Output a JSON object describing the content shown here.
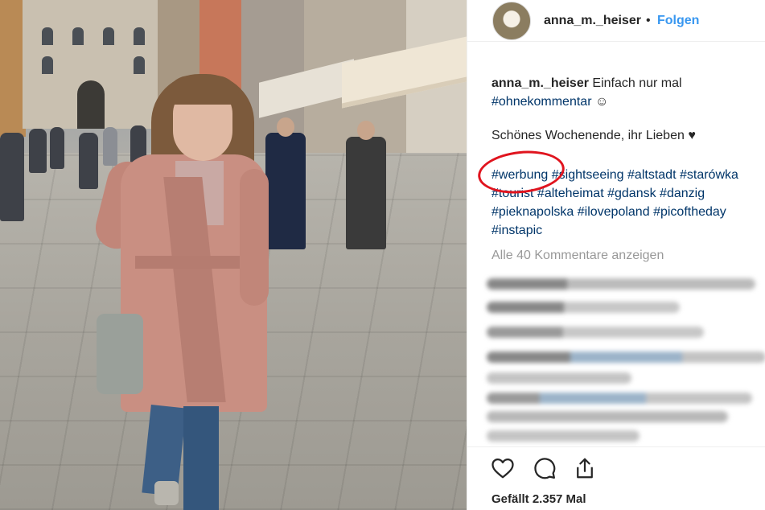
{
  "post": {
    "username": "anna_m._heiser",
    "separator": "•",
    "follow_label": "Folgen"
  },
  "caption": {
    "username": "anna_m._heiser",
    "text": "Einfach nur mal",
    "hashtag_1": "#ohnekommentar",
    "emoji": "☺",
    "line_2": "Schönes Wochenende, ihr Lieben ♥",
    "hashtags_row_1": [
      "#werbung",
      "#sightseeing",
      "#altstadt",
      "#starówka"
    ],
    "hashtags_row_2": [
      "#tourist",
      "#alteheimat",
      "#gdansk",
      "#danzig"
    ],
    "hashtags_row_3": [
      "#pieknapolska",
      "#ilovepoland",
      "#picoftheday"
    ],
    "hashtags_row_4": [
      "#instapic"
    ]
  },
  "comments": {
    "show_all_label": "Alle 40 Kommentare anzeigen"
  },
  "footer": {
    "likes_label": "Gefällt 2.357 Mal",
    "icons": [
      "heart-icon",
      "comment-icon",
      "share-icon"
    ]
  },
  "colors": {
    "link": "#003569",
    "follow": "#3897f0",
    "annotation_circle": "#e0141e"
  }
}
